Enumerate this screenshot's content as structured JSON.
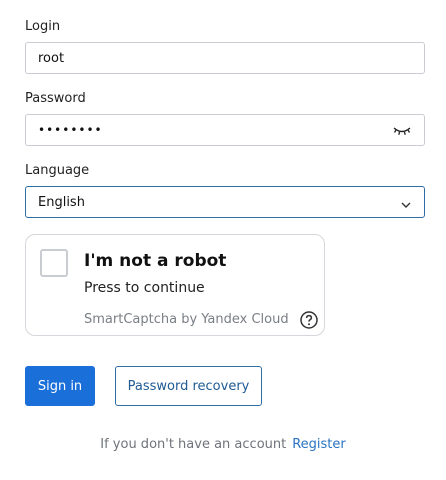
{
  "login": {
    "label": "Login",
    "value": "root"
  },
  "password": {
    "label": "Password",
    "value": "••••••••",
    "toggle_icon": "eye-closed-icon"
  },
  "language": {
    "label": "Language",
    "selected": "English",
    "dropdown_icon": "chevron-down-icon"
  },
  "captcha": {
    "title": "I'm not a robot",
    "subtitle": "Press to continue",
    "brand": "SmartCaptcha by Yandex Cloud",
    "help_icon": "question-circle-icon"
  },
  "actions": {
    "sign_in": "Sign in",
    "password_recovery": "Password recovery"
  },
  "footer": {
    "text": "If you don't have an account",
    "register": "Register"
  },
  "colors": {
    "primary": "#1a6fd9",
    "link": "#2a73c2",
    "focus_border": "#2f6ea5"
  }
}
